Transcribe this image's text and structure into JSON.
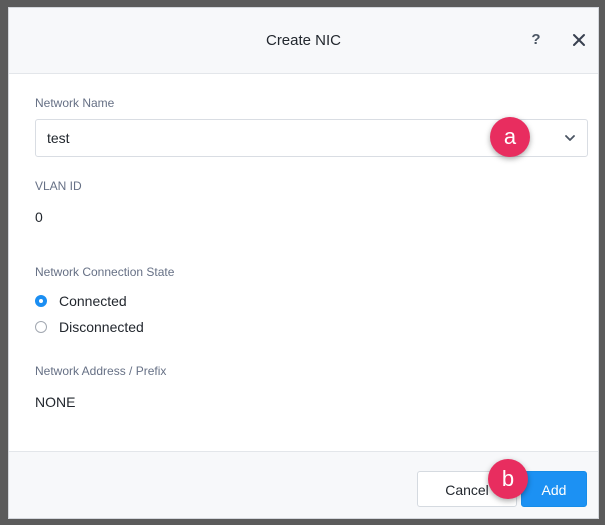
{
  "dialog": {
    "title": "Create NIC",
    "help_symbol": "?",
    "close_icon": "close-icon"
  },
  "form": {
    "network_name": {
      "label": "Network Name",
      "value": "test"
    },
    "vlan_id": {
      "label": "VLAN ID",
      "value": "0"
    },
    "connection_state": {
      "label": "Network Connection State",
      "options": [
        {
          "label": "Connected",
          "checked": true
        },
        {
          "label": "Disconnected",
          "checked": false
        }
      ]
    },
    "address_prefix": {
      "label": "Network Address / Prefix",
      "value": "NONE"
    }
  },
  "buttons": {
    "cancel": "Cancel",
    "add": "Add"
  },
  "annotations": {
    "a": "a",
    "b": "b"
  },
  "colors": {
    "accent": "#1c91f3",
    "callout": "#e82d5f"
  }
}
